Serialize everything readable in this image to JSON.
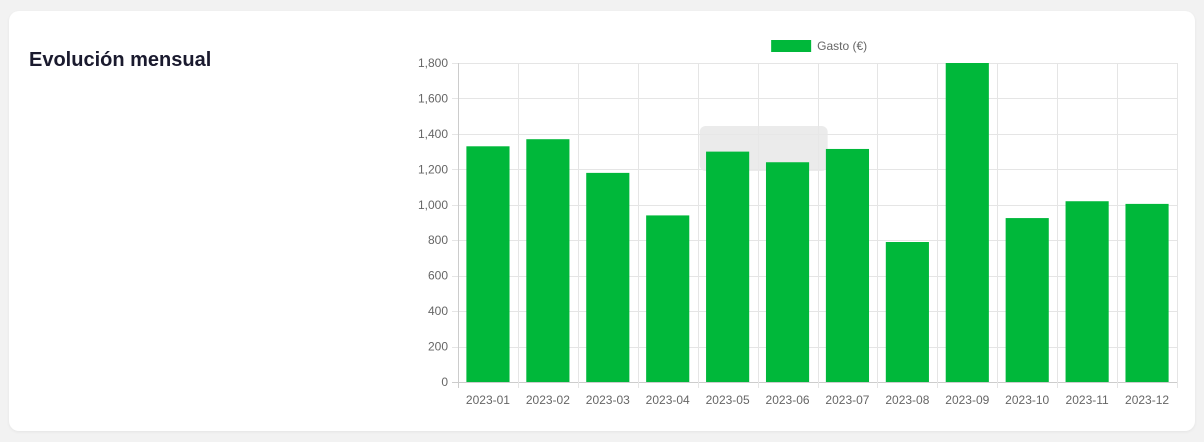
{
  "card": {
    "title": "Evolución mensual"
  },
  "colors": {
    "bar": "#00b83a",
    "grid": "#e5e5e5",
    "axis": "#cccccc",
    "text": "#666666",
    "tooltip": "#e8e8e8"
  },
  "chart_data": {
    "type": "bar",
    "title": "",
    "xlabel": "",
    "ylabel": "",
    "categories": [
      "2023-01",
      "2023-02",
      "2023-03",
      "2023-04",
      "2023-05",
      "2023-06",
      "2023-07",
      "2023-08",
      "2023-09",
      "2023-10",
      "2023-11",
      "2023-12"
    ],
    "series": [
      {
        "name": "Gasto (€)",
        "values": [
          1330,
          1370,
          1180,
          940,
          1300,
          1240,
          1315,
          790,
          1800,
          925,
          1020,
          1005
        ]
      }
    ],
    "ylim": [
      0,
      1800
    ],
    "yticks": [
      0,
      200,
      400,
      600,
      800,
      1000,
      1200,
      1400,
      1600,
      1800
    ],
    "ytick_labels": [
      "0",
      "200",
      "400",
      "600",
      "800",
      "1,000",
      "1,200",
      "1,400",
      "1,600",
      "1,800"
    ],
    "grid": true,
    "legend": "top"
  }
}
